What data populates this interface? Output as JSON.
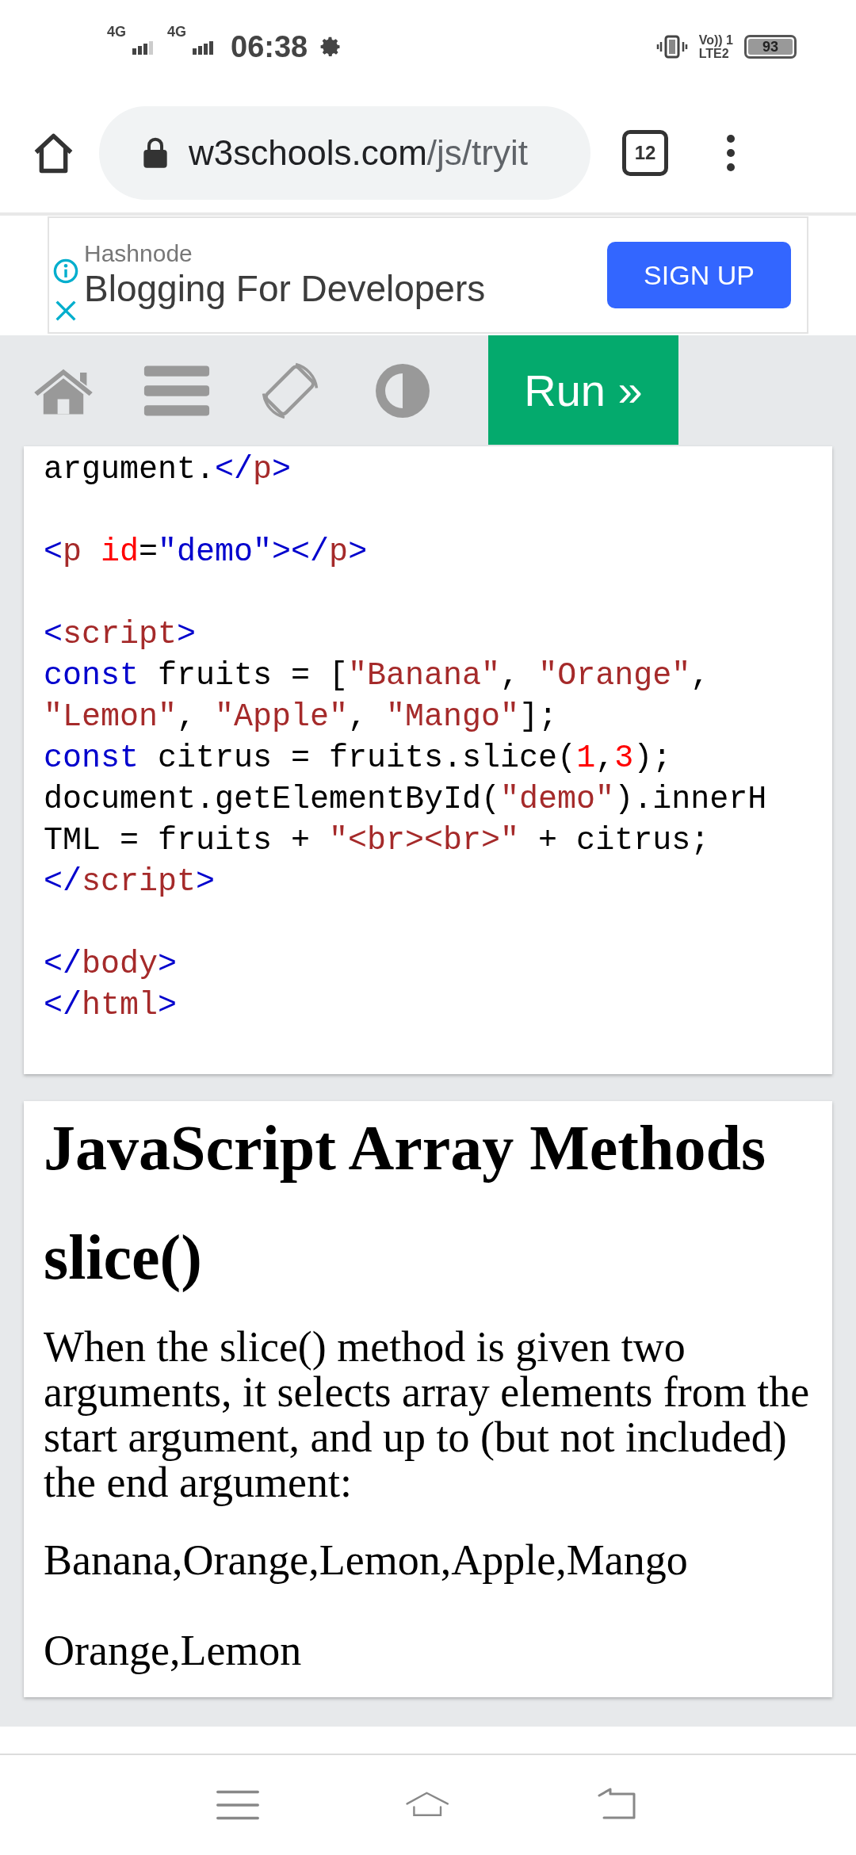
{
  "status_bar": {
    "network_1": "4G",
    "network_2": "4G",
    "time": "06:38",
    "volte": "Vo)) 1",
    "lte": "LTE2",
    "battery": "93"
  },
  "browser": {
    "url_host": "w3schools.com",
    "url_path": "/js/tryit",
    "tab_count": "12"
  },
  "ad": {
    "advertiser": "Hashnode",
    "headline": "Blogging For Developers",
    "button": "SIGN UP"
  },
  "toolbar": {
    "run_button": "Run »"
  },
  "code": [
    {
      "kind": "code",
      "tokens": [
        {
          "kind": "plain",
          "t": "argument."
        },
        {
          "kind": "tag",
          "t": "</p>"
        }
      ]
    },
    {
      "kind": "blank"
    },
    {
      "kind": "code",
      "tokens": [
        {
          "kind": "tag",
          "t": "<p "
        },
        {
          "kind": "attr",
          "t": "id"
        },
        {
          "kind": "plain",
          "t": "="
        },
        {
          "kind": "value",
          "t": "\"demo\""
        },
        {
          "kind": "tag",
          "t": "></p>"
        }
      ]
    },
    {
      "kind": "blank"
    },
    {
      "kind": "code",
      "tokens": [
        {
          "kind": "tag",
          "t": "<script>"
        }
      ]
    },
    {
      "kind": "code",
      "tokens": [
        {
          "kind": "keyword",
          "t": "const"
        },
        {
          "kind": "plain",
          "t": " fruits = ["
        },
        {
          "kind": "string",
          "t": "\"Banana\""
        },
        {
          "kind": "plain",
          "t": ", "
        },
        {
          "kind": "string",
          "t": "\"Orange\""
        },
        {
          "kind": "plain",
          "t": ","
        }
      ]
    },
    {
      "kind": "code",
      "tokens": [
        {
          "kind": "string",
          "t": "\"Lemon\""
        },
        {
          "kind": "plain",
          "t": ", "
        },
        {
          "kind": "string",
          "t": "\"Apple\""
        },
        {
          "kind": "plain",
          "t": ", "
        },
        {
          "kind": "string",
          "t": "\"Mango\""
        },
        {
          "kind": "plain",
          "t": "];"
        }
      ]
    },
    {
      "kind": "code",
      "tokens": [
        {
          "kind": "keyword",
          "t": "const"
        },
        {
          "kind": "plain",
          "t": " citrus = fruits.slice("
        },
        {
          "kind": "number",
          "t": "1"
        },
        {
          "kind": "plain",
          "t": ","
        },
        {
          "kind": "number",
          "t": "3"
        },
        {
          "kind": "plain",
          "t": ");"
        }
      ]
    },
    {
      "kind": "code",
      "tokens": [
        {
          "kind": "plain",
          "t": "document.getElementById("
        },
        {
          "kind": "string",
          "t": "\"demo\""
        },
        {
          "kind": "plain",
          "t": ").innerH"
        }
      ]
    },
    {
      "kind": "code",
      "tokens": [
        {
          "kind": "plain",
          "t": "TML = fruits + "
        },
        {
          "kind": "string",
          "t": "\"<br><br>\""
        },
        {
          "kind": "plain",
          "t": " + citrus;"
        }
      ]
    },
    {
      "kind": "code",
      "tokens": [
        {
          "kind": "tag",
          "t": "</script>"
        }
      ]
    },
    {
      "kind": "blank"
    },
    {
      "kind": "code",
      "tokens": [
        {
          "kind": "tag",
          "t": "</body>"
        }
      ]
    },
    {
      "kind": "code",
      "tokens": [
        {
          "kind": "tag",
          "t": "</html>"
        }
      ]
    }
  ],
  "result": {
    "heading": "JavaScript Array Methods",
    "subheading": "slice()",
    "paragraph": "When the slice() method is given two arguments, it selects array elements from the start argument, and up to (but not included) the end argument:",
    "output_1": "Banana,Orange,Lemon,Apple,Mango",
    "output_2": "Orange,Lemon"
  }
}
